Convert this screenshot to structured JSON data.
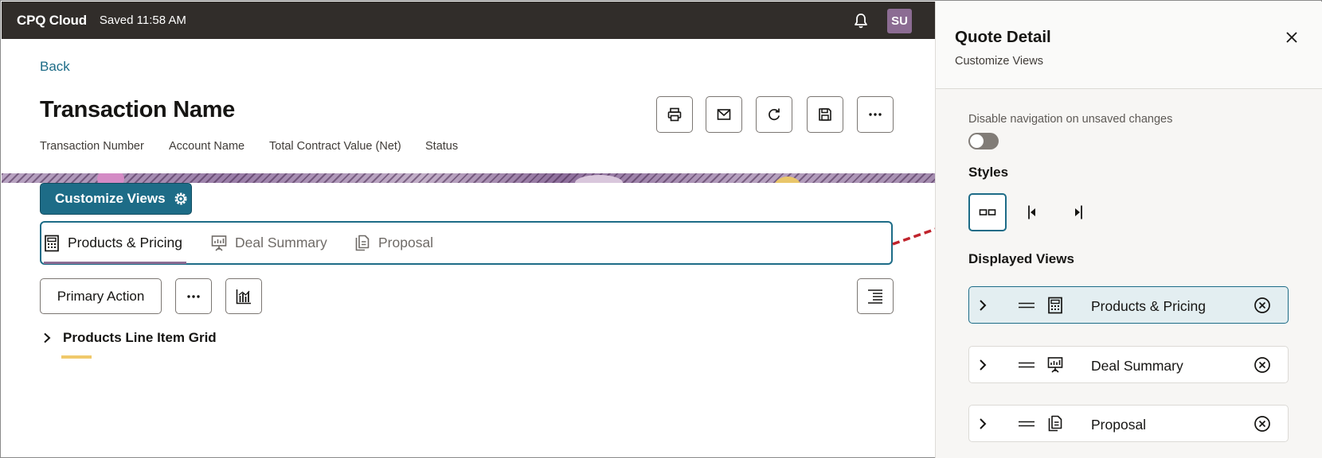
{
  "header": {
    "app_title": "CPQ Cloud",
    "saved_status": "Saved 11:58 AM",
    "avatar_initials": "SU"
  },
  "page": {
    "back_label": "Back",
    "title": "Transaction Name",
    "meta_fields": [
      "Transaction Number",
      "Account Name",
      "Total Contract Value (Net)",
      "Status"
    ],
    "toolbar_icons": [
      "print-icon",
      "email-icon",
      "refresh-icon",
      "save-icon",
      "more-icon"
    ],
    "customize_label": "Customize Views",
    "tabs": [
      {
        "label": "Products & Pricing",
        "icon": "calculator-icon",
        "active": true
      },
      {
        "label": "Deal Summary",
        "icon": "presentation-icon",
        "active": false
      },
      {
        "label": "Proposal",
        "icon": "document-icon",
        "active": false
      }
    ],
    "primary_action_label": "Primary Action",
    "grid_title": "Products Line Item Grid"
  },
  "panel": {
    "title": "Quote Detail",
    "subtitle": "Customize Views",
    "disable_nav_label": "Disable navigation on unsaved changes",
    "disable_nav_on": false,
    "styles_label": "Styles",
    "style_options": [
      "tabs-style-icon",
      "left-align-icon",
      "right-align-icon"
    ],
    "displayed_views_label": "Displayed Views",
    "views": [
      {
        "label": "Products & Pricing",
        "icon": "calculator-icon",
        "active": true
      },
      {
        "label": "Deal Summary",
        "icon": "presentation-icon",
        "active": false
      },
      {
        "label": "Proposal",
        "icon": "document-icon",
        "active": false
      }
    ]
  },
  "colors": {
    "topbar": "#312d2a",
    "accent": "#1d6c87",
    "avatar": "#8c6c93",
    "arrow": "#c0232c"
  }
}
